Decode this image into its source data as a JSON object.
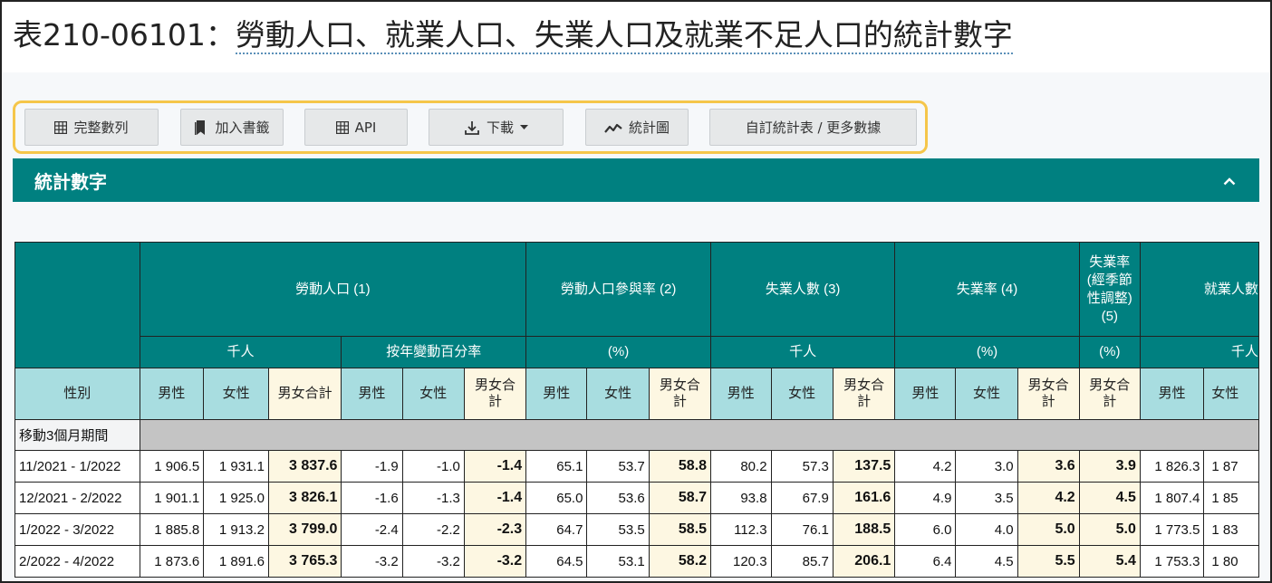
{
  "page": {
    "title_prefix": "表210-06101：",
    "title_link": "勞動人口、就業人口、失業人口及就業不足人口的統計數字"
  },
  "toolbar": {
    "full_series": "完整數列",
    "bookmark": "加入書籤",
    "api": "API",
    "download": "下載",
    "chart": "統計圖",
    "custom": "自訂統計表 / 更多數據"
  },
  "section": {
    "title": "統計數字"
  },
  "table": {
    "group_headers": {
      "labour_force": "勞動人口 (1)",
      "lfpr": "勞動人口參與率 (2)",
      "unemployed": "失業人數 (3)",
      "unemp_rate": "失業率 (4)",
      "unemp_rate_sa": "失業率\n(經季節\n性調整)\n(5)",
      "employed": "就業人數"
    },
    "unit_headers": {
      "thousand": "千人",
      "yoy": "按年變動百分率",
      "percent": "(%)",
      "percent2": "(%)",
      "percent3": "(%)",
      "thousand2": "千人",
      "thousand3": "千人"
    },
    "sub_headers": {
      "sex": "性別",
      "male": "男性",
      "female": "女性",
      "total": "男女合計",
      "total_wrap": "男女合\n計"
    },
    "period_label": "移動3個月期間",
    "rows": [
      {
        "period": "11/2021 - 1/2022",
        "lf": [
          "1 906.5",
          "1 931.1",
          "3 837.6"
        ],
        "yoy": [
          "-1.9",
          "-1.0",
          "-1.4"
        ],
        "lfpr": [
          "65.1",
          "53.7",
          "58.8"
        ],
        "unemp": [
          "80.2",
          "57.3",
          "137.5"
        ],
        "rate": [
          "4.2",
          "3.0",
          "3.6"
        ],
        "sa": "3.9",
        "emp": [
          "1 826.3",
          "1 87"
        ]
      },
      {
        "period": "12/2021 - 2/2022",
        "lf": [
          "1 901.1",
          "1 925.0",
          "3 826.1"
        ],
        "yoy": [
          "-1.6",
          "-1.3",
          "-1.4"
        ],
        "lfpr": [
          "65.0",
          "53.6",
          "58.7"
        ],
        "unemp": [
          "93.8",
          "67.9",
          "161.6"
        ],
        "rate": [
          "4.9",
          "3.5",
          "4.2"
        ],
        "sa": "4.5",
        "emp": [
          "1 807.4",
          "1 85"
        ]
      },
      {
        "period": "1/2022 - 3/2022",
        "lf": [
          "1 885.8",
          "1 913.2",
          "3 799.0"
        ],
        "yoy": [
          "-2.4",
          "-2.2",
          "-2.3"
        ],
        "lfpr": [
          "64.7",
          "53.5",
          "58.5"
        ],
        "unemp": [
          "112.3",
          "76.1",
          "188.5"
        ],
        "rate": [
          "6.0",
          "4.0",
          "5.0"
        ],
        "sa": "5.0",
        "emp": [
          "1 773.5",
          "1 83"
        ]
      },
      {
        "period": "2/2022 - 4/2022",
        "lf": [
          "1 873.6",
          "1 891.6",
          "3 765.3"
        ],
        "yoy": [
          "-3.2",
          "-3.2",
          "-3.2"
        ],
        "lfpr": [
          "64.5",
          "53.1",
          "58.2"
        ],
        "unemp": [
          "120.3",
          "85.7",
          "206.1"
        ],
        "rate": [
          "6.4",
          "4.5",
          "5.5"
        ],
        "sa": "5.4",
        "emp": [
          "1 753.3",
          "1 80"
        ]
      }
    ]
  },
  "colors": {
    "teal": "#008080",
    "light_teal": "#a8dde0",
    "highlight": "#f5c64a",
    "total_bg": "#fdf7e2",
    "period_bar": "#c4c4c4"
  },
  "icons": {
    "full_series": "grid-icon",
    "bookmark": "bookmark-icon",
    "api": "grid-icon",
    "download": "download-icon",
    "chart": "line-chart-icon",
    "collapse": "chevron-up-icon"
  }
}
